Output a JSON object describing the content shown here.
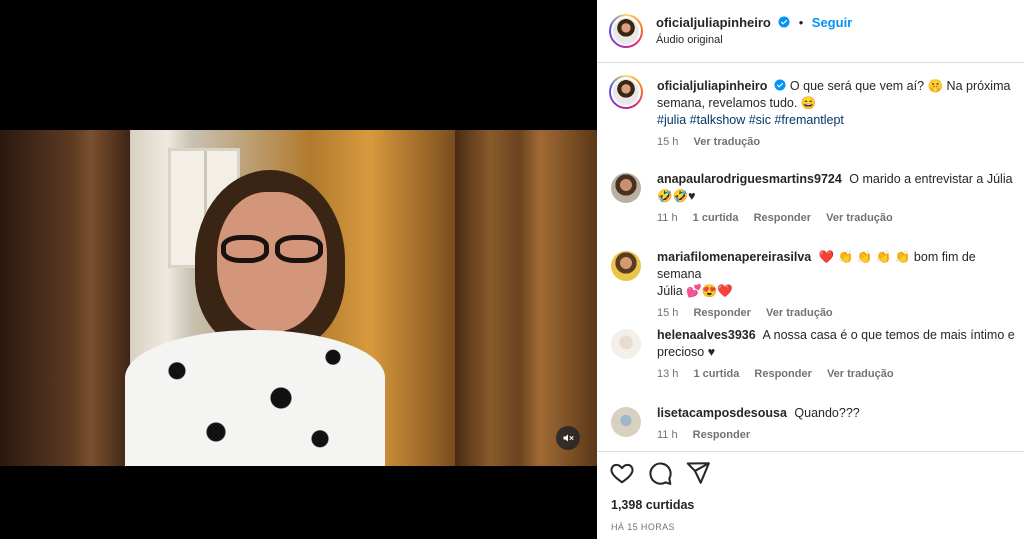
{
  "post": {
    "author": "oficialjuliapinheiro",
    "follow_label": "Seguir",
    "audio": "Áudio original",
    "separator": "•"
  },
  "caption": {
    "username": "oficialjuliapinheiro",
    "text_line1": "O que será que vem aí? 🤫 Na próxima",
    "text_line2": "semana, revelamos tudo. 😄",
    "hashtags": "#julia #talkshow #sic #fremantlept",
    "time": "15 h",
    "see_translation": "Ver tradução"
  },
  "comments": [
    {
      "username": "anapaularodriguesmartins9724",
      "text": "O marido a entrevistar a Júlia",
      "text2": "🤣🤣♥",
      "time": "11 h",
      "likes": "1 curtida",
      "reply": "Responder",
      "see_translation": "Ver tradução"
    },
    {
      "username": "mariafilomenapereirasilva",
      "text": "❤️ 👏 👏 👏 👏 bom fim de semana",
      "text2": "Júlia 💕😍❤️",
      "time": "15 h",
      "reply": "Responder",
      "see_translation": "Ver tradução"
    },
    {
      "username": "helenaalves3936",
      "text": "A nossa casa é o que temos de mais íntimo e",
      "text2": "precioso ♥",
      "time": "13 h",
      "likes": "1 curtida",
      "reply": "Responder",
      "see_translation": "Ver tradução"
    },
    {
      "username": "lisetacamposdesousa",
      "text": "Quando???",
      "time": "11 h",
      "reply": "Responder"
    }
  ],
  "footer": {
    "likes": "1,398 curtidas",
    "posted": "HÁ 15 HORAS"
  },
  "icons": {
    "like": "heart-icon",
    "comment": "comment-icon",
    "share": "share-icon",
    "mute": "muted-speaker-icon",
    "verified": "verified-badge-icon"
  },
  "colors": {
    "accent": "#0095f6",
    "hashtag": "#00376b",
    "secondary_text": "#737373",
    "verified": "#0095f6"
  }
}
